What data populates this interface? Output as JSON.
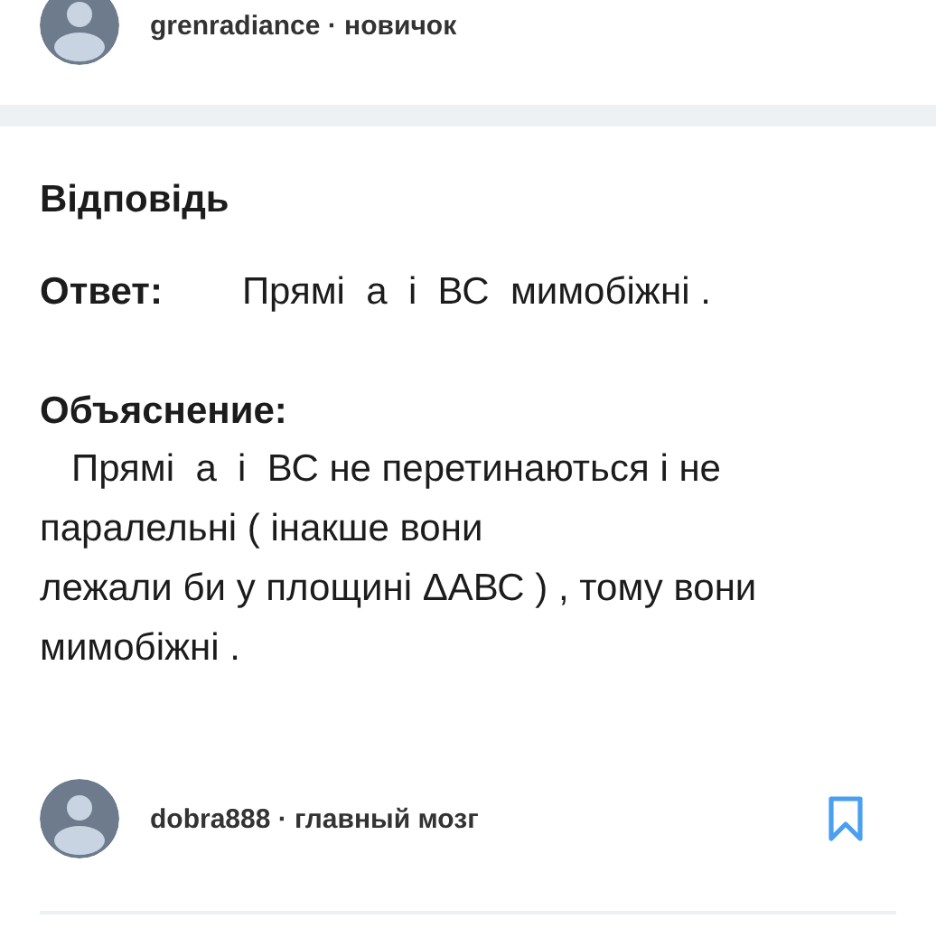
{
  "top_author": {
    "name": "grenradiance · новичок"
  },
  "answer_section": {
    "title": "Відповідь",
    "answer_label": "Ответ:",
    "answer_text": "Прямі  а  і  ВС  мимобіжні .",
    "explanation_label": "Объяснение:",
    "explanation_text": "   Прямі  а  і  ВС не перетинаються і не\nпаралельні ( інакше вони\nлежали би у площині ΔАВС ) , тому вони\nмимобіжні ."
  },
  "bottom_author": {
    "name": "dobra888 · главный мозг"
  }
}
